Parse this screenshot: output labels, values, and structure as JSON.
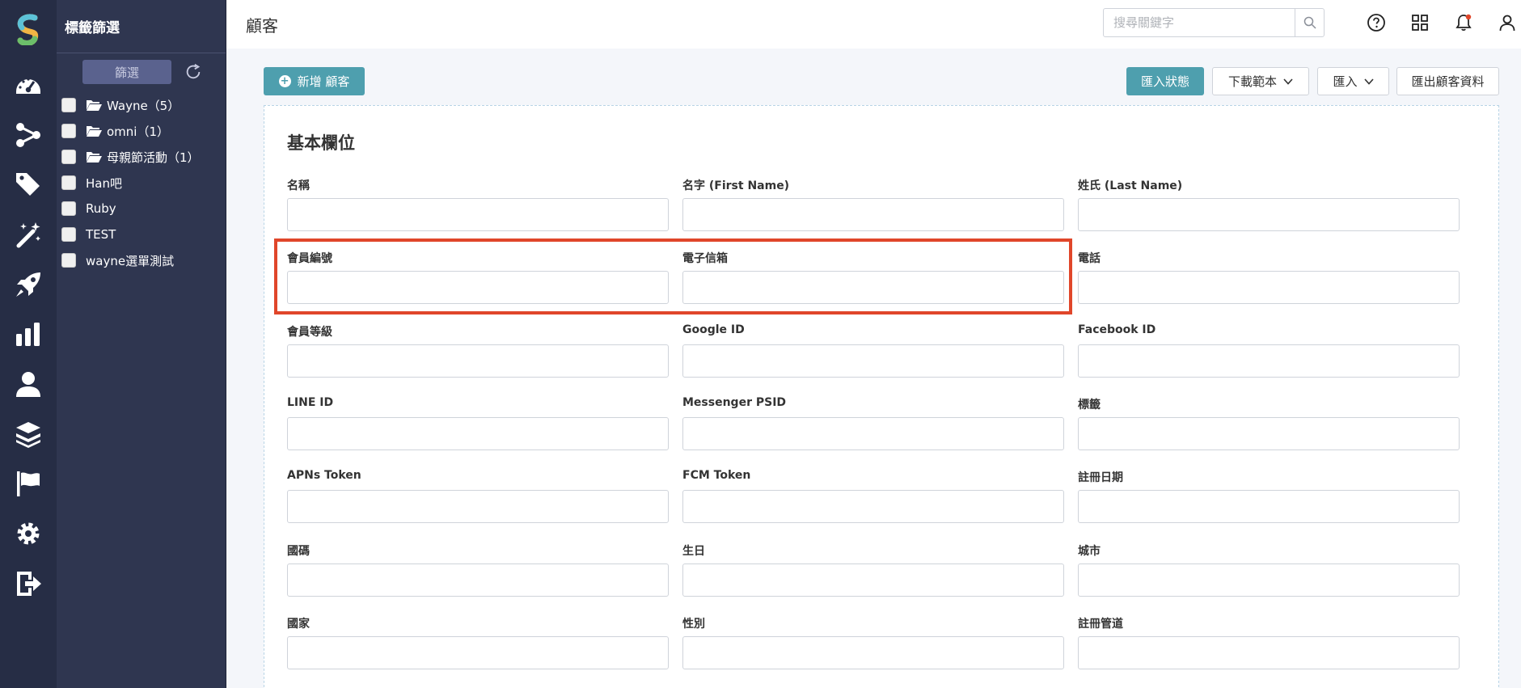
{
  "rail": {
    "icons": [
      "dashboard-icon",
      "flow-icon",
      "tag-icon",
      "magic-wand-icon",
      "rocket-icon",
      "bar-chart-icon",
      "user-icon",
      "layers-icon",
      "flag-icon",
      "gear-icon",
      "logout-icon"
    ]
  },
  "tag_panel": {
    "title": "標籤篩選",
    "filter_label": "篩選",
    "tags": [
      {
        "label": "Wayne（5）",
        "folder": true
      },
      {
        "label": "omni（1）",
        "folder": true
      },
      {
        "label": "母親節活動（1）",
        "folder": true
      },
      {
        "label": "Han吧",
        "folder": false
      },
      {
        "label": "Ruby",
        "folder": false
      },
      {
        "label": "TEST",
        "folder": false
      },
      {
        "label": "wayne選單測試",
        "folder": false
      }
    ]
  },
  "header": {
    "title": "顧客",
    "search_placeholder": "搜尋關鍵字"
  },
  "actions": {
    "new_customer": "新增 顧客",
    "import_status": "匯入狀態",
    "download_template": "下載範本",
    "import": "匯入",
    "export": "匯出顧客資料"
  },
  "form": {
    "section_title": "基本欄位",
    "fields": [
      {
        "label": "名稱"
      },
      {
        "label": "名字 (First Name)"
      },
      {
        "label": "姓氏 (Last Name)"
      },
      {
        "label": "會員編號"
      },
      {
        "label": "電子信箱"
      },
      {
        "label": "電話"
      },
      {
        "label": "會員等級"
      },
      {
        "label": "Google ID"
      },
      {
        "label": "Facebook ID"
      },
      {
        "label": "LINE ID"
      },
      {
        "label": "Messenger PSID"
      },
      {
        "label": "標籤"
      },
      {
        "label": "APNs Token"
      },
      {
        "label": "FCM Token"
      },
      {
        "label": "註冊日期"
      },
      {
        "label": "國碼"
      },
      {
        "label": "生日"
      },
      {
        "label": "城市"
      },
      {
        "label": "國家"
      },
      {
        "label": "性別"
      },
      {
        "label": "註冊管道"
      }
    ]
  },
  "colors": {
    "rail_bg": "#262d45",
    "panel_bg": "#2f3650",
    "accent": "#4e9fae",
    "highlight": "#e0462a",
    "notification_dot": "#e0462a"
  }
}
